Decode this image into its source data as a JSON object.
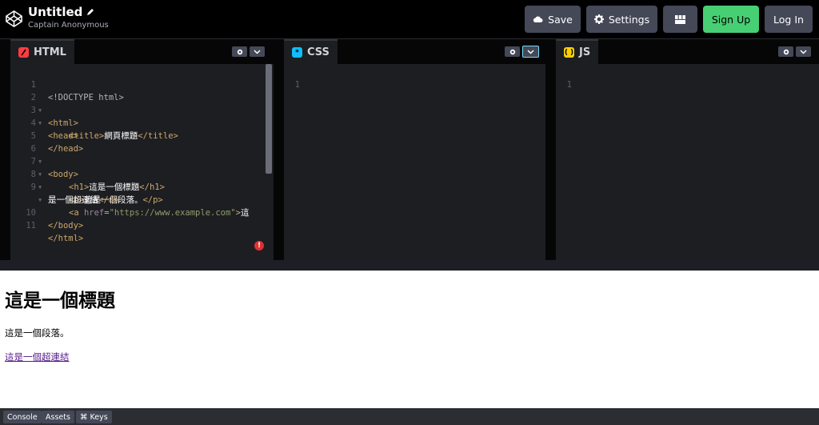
{
  "header": {
    "title": "Untitled",
    "author": "Captain Anonymous",
    "buttons": {
      "save": "Save",
      "settings": "Settings",
      "signup": "Sign Up",
      "login": "Log In"
    }
  },
  "panes": {
    "html": {
      "label": "HTML",
      "lines": [
        {
          "n": "1",
          "fold": false
        },
        {
          "n": "2",
          "fold": true
        },
        {
          "n": "3",
          "fold": true
        },
        {
          "n": "4",
          "fold": false
        },
        {
          "n": "5",
          "fold": false
        },
        {
          "n": "6",
          "fold": true
        },
        {
          "n": "7",
          "fold": true
        },
        {
          "n": "8",
          "fold": true
        },
        {
          "n": "9",
          "fold": true
        },
        {
          "n": "",
          "fold": false
        },
        {
          "n": "10",
          "fold": false
        },
        {
          "n": "11",
          "fold": false
        }
      ],
      "code": {
        "l1": "<!DOCTYPE html>",
        "l2": "<html>",
        "l3": "<head>",
        "l4_open": "<title>",
        "l4_text": "網頁標題",
        "l4_close": "</title>",
        "l5": "</head>",
        "l6": "<body>",
        "l7_open": "<h1>",
        "l7_text": "這是一個標題",
        "l7_close": "</h1>",
        "l8_open": "<p>",
        "l8_text": "這是一個段落。",
        "l8_close": "</p>",
        "l9_open": "<a ",
        "l9_attr": "href",
        "l9_eq": "=",
        "l9_str": "\"https://www.example.com\"",
        "l9_gt": ">",
        "l9_text": "這",
        "l9b_text": "是一個超連結",
        "l9b_close": "</a>",
        "l10": "</body>",
        "l11": "</html>"
      },
      "error_icon": "!"
    },
    "css": {
      "label": "CSS",
      "line1": "1"
    },
    "js": {
      "label": "JS",
      "line1": "1"
    }
  },
  "preview": {
    "heading": "這是一個標題",
    "paragraph": "這是一個段落。",
    "link": "這是一個超連結"
  },
  "footer": {
    "console": "Console",
    "assets": "Assets",
    "keys": "⌘ Keys"
  },
  "colors": {
    "signup_green": "#47cf73",
    "button_gray": "#444857",
    "html_icon": "#ff3c41",
    "css_icon": "#0ebeff",
    "js_icon": "#fcd000"
  }
}
